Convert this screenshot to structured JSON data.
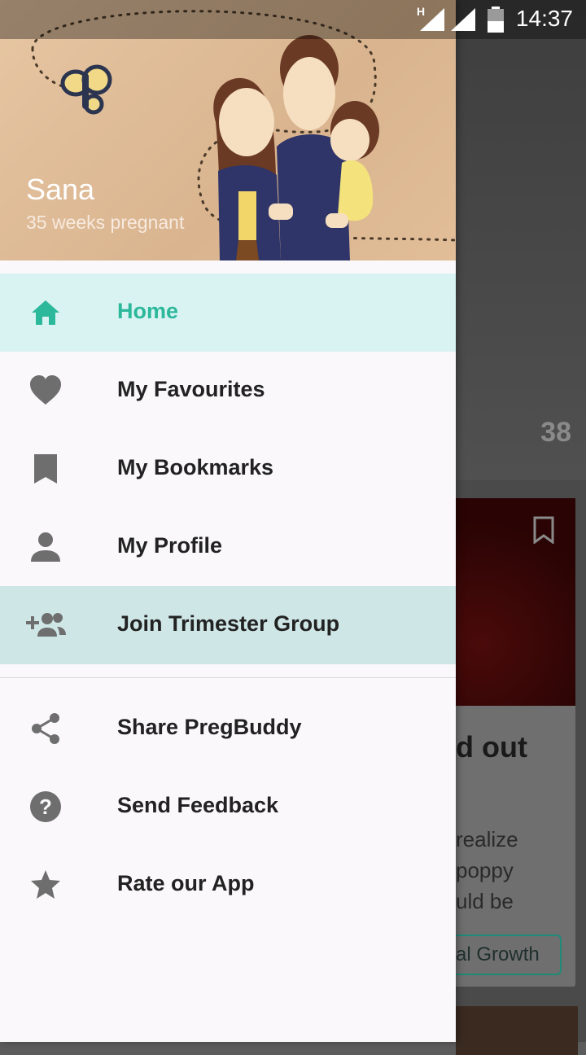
{
  "status_bar": {
    "time": "14:37",
    "network_label": "H",
    "icons": [
      "signal-icon",
      "signal-icon",
      "battery-icon"
    ]
  },
  "drawer": {
    "user": {
      "name": "Sana",
      "subtitle": "35 weeks pregnant"
    },
    "items": [
      {
        "label": "Home",
        "icon": "home-icon",
        "active": true
      },
      {
        "label": "My Favourites",
        "icon": "heart-icon"
      },
      {
        "label": "My Bookmarks",
        "icon": "bookmark-icon"
      },
      {
        "label": "My Profile",
        "icon": "person-icon"
      },
      {
        "label": "Join Trimester Group",
        "icon": "group-add-icon",
        "highlighted": true
      }
    ],
    "secondary_items": [
      {
        "label": "Share PregBuddy",
        "icon": "share-icon"
      },
      {
        "label": "Send Feedback",
        "icon": "help-icon"
      },
      {
        "label": "Rate our App",
        "icon": "star-icon"
      }
    ],
    "accent_color": "#2cb89a"
  },
  "background": {
    "count": "38",
    "card_title": "d out",
    "card_lines": [
      "realize",
      "poppy",
      "uld be"
    ],
    "tag": "etal Growth"
  }
}
